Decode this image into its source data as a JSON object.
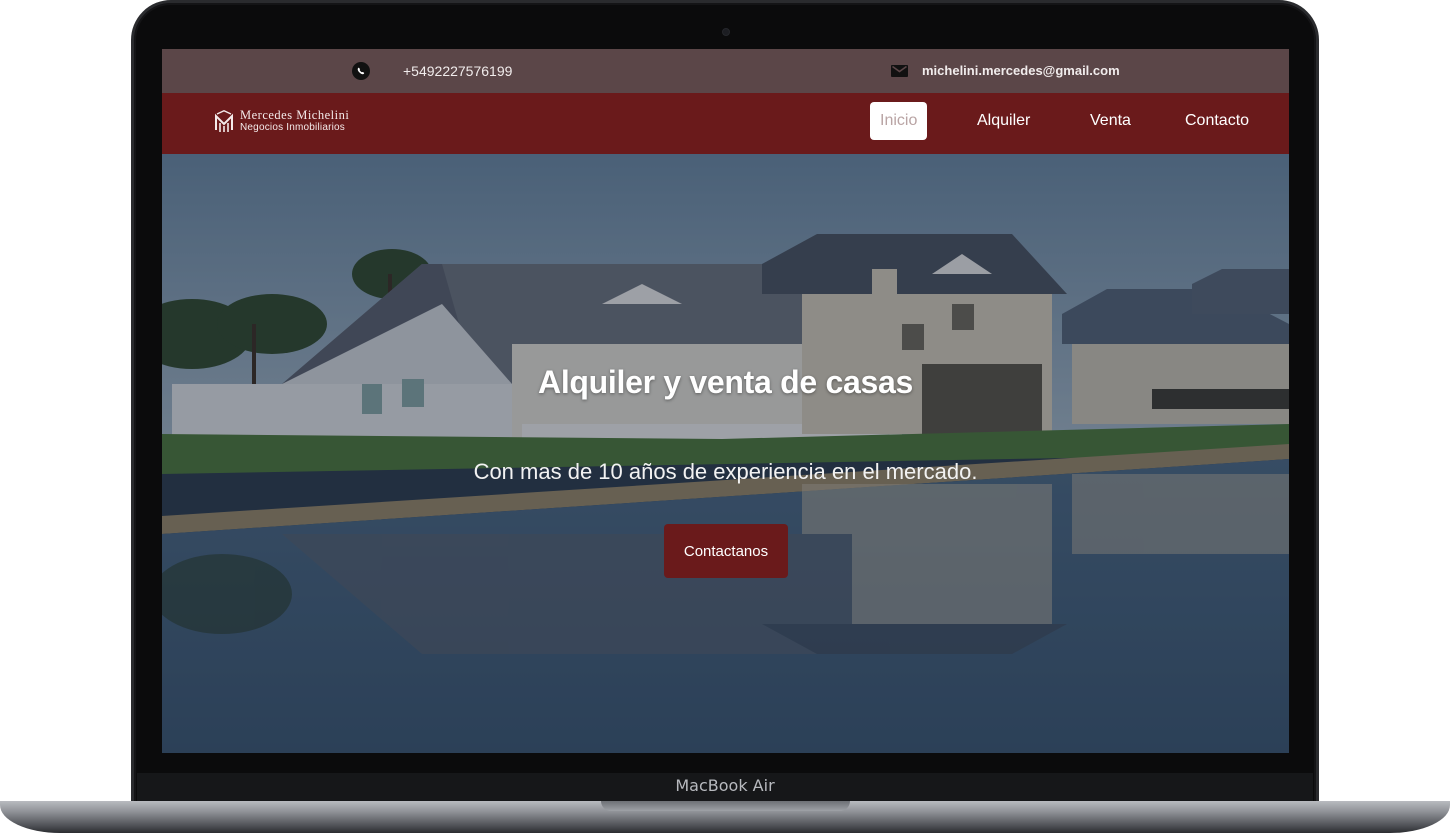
{
  "device": {
    "label": "MacBook Air"
  },
  "topbar": {
    "phone": "+5492227576199",
    "email": "michelini.mercedes@gmail.com",
    "icons": [
      "whatsapp-icon",
      "mail-icon"
    ]
  },
  "navbar": {
    "brand_name": "Mercedes Michelini",
    "brand_sub": "Negocios Inmobiliarios",
    "items": [
      {
        "label": "Inicio",
        "active": true
      },
      {
        "label": "Alquiler",
        "active": false
      },
      {
        "label": "Venta",
        "active": false
      },
      {
        "label": "Contacto",
        "active": false
      }
    ]
  },
  "hero": {
    "title": "Alquiler y venta de casas",
    "subtitle": "Con mas de 10 años de experiencia en el mercado.",
    "cta_label": "Contactanos"
  },
  "colors": {
    "topbar_bg": "#5b4648",
    "navbar_bg": "#6a1a1b",
    "accent": "#6a1a1b",
    "active_tab_bg": "#ffffff"
  }
}
